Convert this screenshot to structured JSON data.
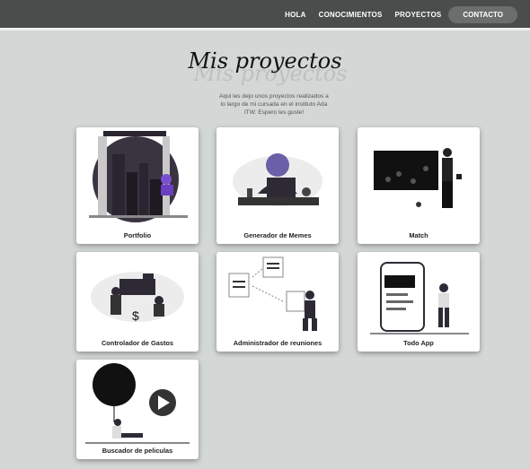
{
  "nav": {
    "items": [
      "HOLA",
      "CONOCIMIENTOS",
      "PROYECTOS"
    ],
    "cta": "CONTACTO"
  },
  "header": {
    "title": "Mis proyectos",
    "subtitle_lines": [
      "Aqui les dejo unos proyectos realizados a",
      "lo largo de mi cursada en el instituto Ada",
      "ITW. Espero les guste!"
    ]
  },
  "projects": [
    {
      "label": "Portfolio",
      "icon": "city-night-illustration"
    },
    {
      "label": "Generador de Memes",
      "icon": "laptop-woman-illustration"
    },
    {
      "label": "Match",
      "icon": "game-board-illustration"
    },
    {
      "label": "Controlador de Gastos",
      "icon": "expenses-illustration"
    },
    {
      "label": "Administrador de reuniones",
      "icon": "documents-illustration"
    },
    {
      "label": "Todo App",
      "icon": "phone-app-illustration"
    },
    {
      "label": "Buscador de peliculas",
      "icon": "movie-play-illustration"
    }
  ]
}
